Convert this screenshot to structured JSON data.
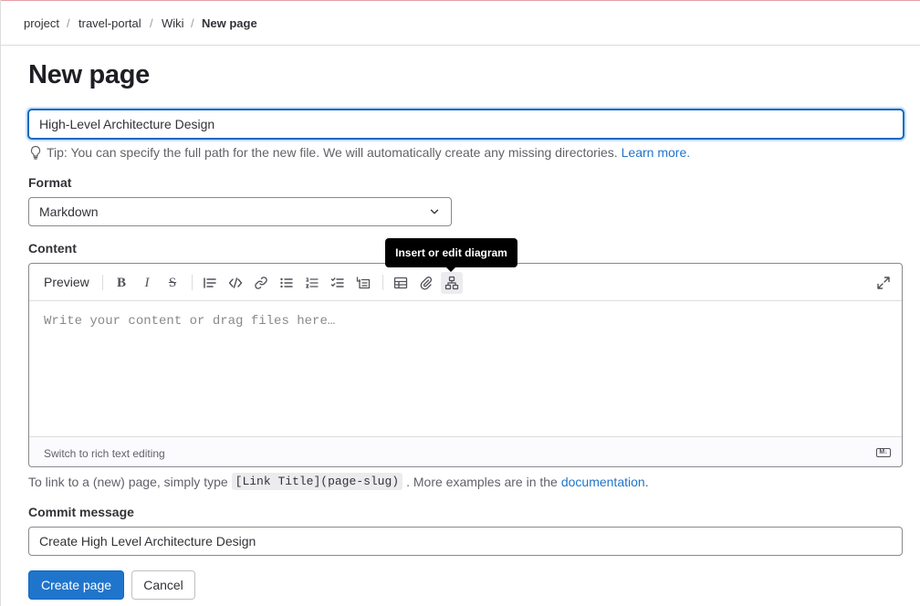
{
  "breadcrumb": {
    "items": [
      "project",
      "travel-portal",
      "Wiki",
      "New page"
    ],
    "separator": "/"
  },
  "page": {
    "title": "New page"
  },
  "title_field": {
    "value": "High-Level Architecture Design",
    "tip": "Tip: You can specify the full path for the new file. We will automatically create any missing directories.",
    "tip_link": "Learn more."
  },
  "format": {
    "label": "Format",
    "selected": "Markdown"
  },
  "content": {
    "label": "Content",
    "tooltip": "Insert or edit diagram",
    "preview_label": "Preview",
    "placeholder": "Write your content or drag files here…",
    "switch_link": "Switch to rich text editing",
    "markdown_badge": "M↓",
    "toolbar_icons": [
      "bold-icon",
      "italic-icon",
      "strikethrough-icon",
      "quote-icon",
      "code-icon",
      "link-icon",
      "bulleted-list-icon",
      "numbered-list-icon",
      "task-list-icon",
      "collapsible-section-icon",
      "table-icon",
      "attach-file-icon",
      "diagram-icon",
      "fullscreen-icon"
    ]
  },
  "help": {
    "prefix": "To link to a (new) page, simply type",
    "code": "[Link Title](page-slug)",
    "middle": ". More examples are in the",
    "link": "documentation",
    "suffix": "."
  },
  "commit": {
    "label": "Commit message",
    "value": "Create High Level Architecture Design"
  },
  "actions": {
    "submit": "Create page",
    "cancel": "Cancel"
  },
  "colors": {
    "primary": "#1f75cb",
    "focus_border": "#1068bf",
    "text": "#333238",
    "muted": "#626168",
    "tooltip_bg": "#000000"
  }
}
